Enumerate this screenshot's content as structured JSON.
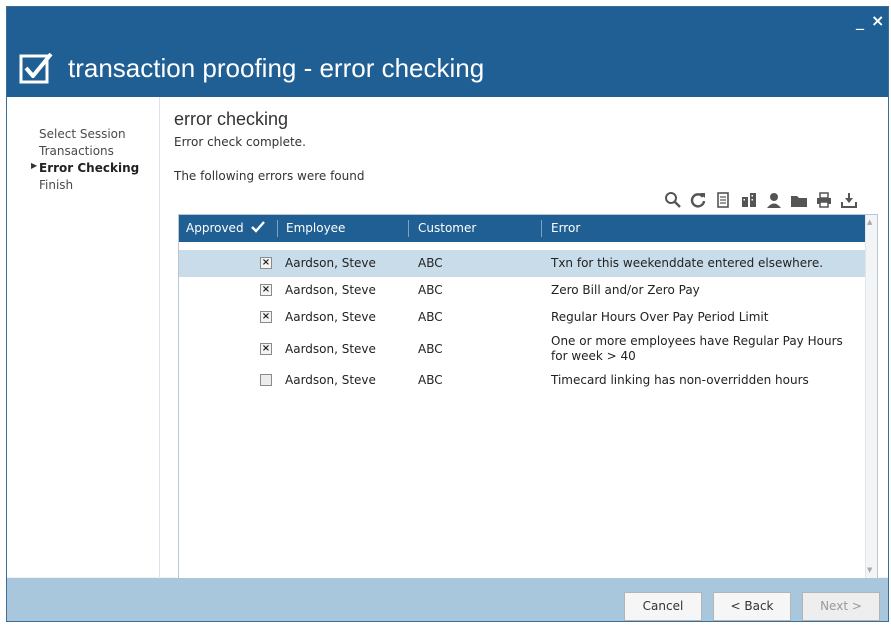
{
  "window": {
    "title": "transaction proofing - error checking",
    "minimize_label": "_",
    "close_label": "×"
  },
  "sidebar": {
    "items": [
      {
        "label": "Select Session",
        "active": false
      },
      {
        "label": "Transactions",
        "active": false
      },
      {
        "label": "Error Checking",
        "active": true
      },
      {
        "label": "Finish",
        "active": false
      }
    ]
  },
  "main": {
    "title": "error checking",
    "status": "Error check complete.",
    "errors_found": "The following errors were found"
  },
  "toolbar": {
    "icons": [
      "search-icon",
      "refresh-icon",
      "document-icon",
      "organization-icon",
      "person-icon",
      "folder-icon",
      "print-icon",
      "export-icon"
    ]
  },
  "grid": {
    "columns": {
      "approved": "Approved",
      "employee": "Employee",
      "customer": "Customer",
      "error": "Error"
    },
    "rows": [
      {
        "approved": true,
        "employee": "Aardson, Steve",
        "customer": "ABC",
        "error": "Txn for this weekenddate entered elsewhere.",
        "selected": true
      },
      {
        "approved": true,
        "employee": "Aardson, Steve",
        "customer": "ABC",
        "error": "Zero Bill and/or Zero Pay",
        "selected": false
      },
      {
        "approved": true,
        "employee": "Aardson, Steve",
        "customer": "ABC",
        "error": "Regular Hours Over Pay Period Limit",
        "selected": false
      },
      {
        "approved": true,
        "employee": "Aardson, Steve",
        "customer": "ABC",
        "error": "One or more employees have Regular Pay Hours for week > 40",
        "selected": false
      },
      {
        "approved": false,
        "employee": "Aardson, Steve",
        "customer": "ABC",
        "error": "Timecard linking has non-overridden hours",
        "selected": false
      }
    ]
  },
  "footer": {
    "cancel": "Cancel",
    "back": "< Back",
    "next": "Next >"
  },
  "colors": {
    "title_bar": "#1f5f93",
    "footer": "#a9c7dc",
    "selected_row": "#c8dcea"
  }
}
